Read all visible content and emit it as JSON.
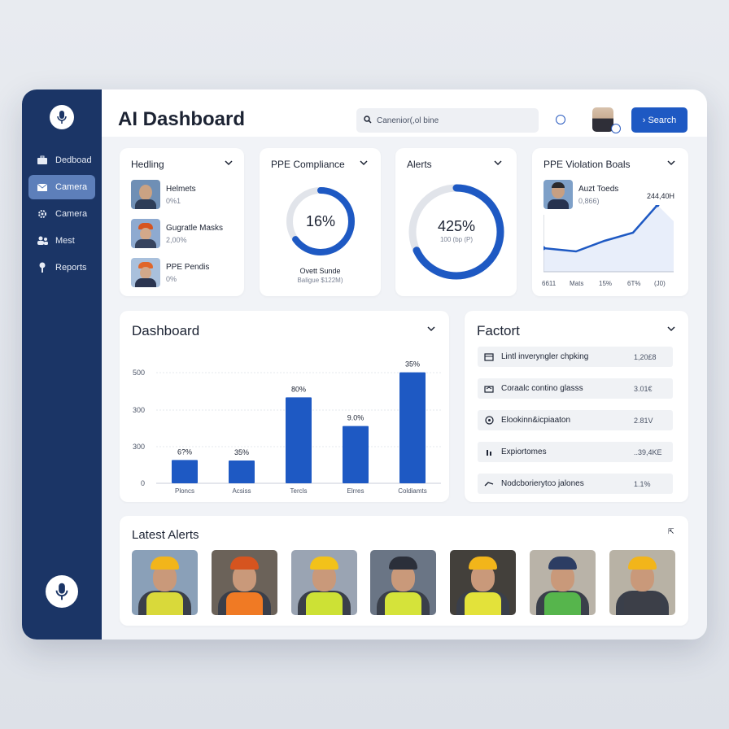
{
  "app": {
    "title": "AI Dashboard"
  },
  "search": {
    "placeholder": "Canenior(,ol bine",
    "button_label": "Search"
  },
  "sidebar": {
    "items": [
      {
        "label": "Dedboad",
        "icon": "briefcase-icon",
        "active": false
      },
      {
        "label": "Camera",
        "icon": "mail-icon",
        "active": true
      },
      {
        "label": "Camera",
        "icon": "gear-icon",
        "active": false
      },
      {
        "label": "Mest",
        "icon": "people-icon",
        "active": false
      },
      {
        "label": "Reports",
        "icon": "pin-icon",
        "active": false
      }
    ]
  },
  "cards": {
    "hedling": {
      "title": "Hedling",
      "rows": [
        {
          "name": "Helmets",
          "value": "0%1"
        },
        {
          "name": "Gugratle Masks",
          "value": "2,00%"
        },
        {
          "name": "PPE Pendis",
          "value": "0%"
        }
      ]
    },
    "compliance": {
      "title": "PPE Compliance",
      "value": "16%",
      "sub1": "Ovett Sunde",
      "sub2": "Baligue $122M)",
      "percent": 65
    },
    "alerts": {
      "title": "Alerts",
      "value": "425%",
      "sub": "100 (bp (P)",
      "percent": 68
    },
    "violation": {
      "title": "PPE Violation Boals",
      "name": "Auzt Toeds",
      "sub": "0,866)",
      "peak_label": "244,40H",
      "xlabels": [
        "6611",
        "Mats",
        "15%",
        "6T%",
        "(J0)"
      ]
    }
  },
  "dashboard": {
    "title": "Dashboard",
    "chart_data": {
      "type": "bar",
      "categories": [
        "Ploncs",
        "Acsiss",
        "Tercls",
        "Elrres",
        "Coldiamts"
      ],
      "values": [
        130,
        127,
        480,
        320,
        620
      ],
      "data_labels": [
        "6?%",
        "35%",
        "80%",
        "9.0%",
        "35%"
      ],
      "yticks": [
        "500",
        "300",
        "300",
        "0"
      ],
      "ylim": [
        0,
        700
      ]
    }
  },
  "factort": {
    "title": "Factort",
    "rows": [
      {
        "label": "Lintl inveryngler chpking",
        "value": "1,20£8",
        "icon": "box-icon"
      },
      {
        "label": "Coraalc contino glasss",
        "value": "3.01€",
        "icon": "glasses-icon"
      },
      {
        "label": "Elookinn&icpiaaton",
        "value": "2.81V",
        "icon": "face-icon"
      },
      {
        "label": "Expiortomes",
        "value": "..39,4KE",
        "icon": "people-small-icon"
      },
      {
        "label": "Nodcborierytoɔ jalones",
        "value": "1.1%",
        "icon": "arrow-icon"
      }
    ]
  },
  "latest_alerts": {
    "title": "Latest Alerts",
    "photos": [
      {
        "name": "worker-1",
        "helmet": "#f2b51a",
        "vest": "#d9d93a",
        "bg": "#8aa0b8"
      },
      {
        "name": "worker-2",
        "helmet": "#d6541f",
        "vest": "#f07a24",
        "bg": "#6b6259"
      },
      {
        "name": "worker-3",
        "helmet": "#f2c21a",
        "vest": "#cde135",
        "bg": "#9aa4b3"
      },
      {
        "name": "worker-4",
        "helmet": "#2b2f3a",
        "vest": "#d5e33a",
        "bg": "#6a7585"
      },
      {
        "name": "worker-5",
        "helmet": "#f2b51a",
        "vest": "#e3e23a",
        "bg": "#43403b"
      },
      {
        "name": "worker-6",
        "helmet": "#2c3d63",
        "vest": "#56b54c",
        "bg": "#b9b3a8"
      },
      {
        "name": "worker-7",
        "helmet": "#f2b51a",
        "vest": "#3c3f48",
        "bg": "#b8b2a5"
      }
    ]
  },
  "colors": {
    "sidebar": "#1b3566",
    "accent": "#1e59c3",
    "active_nav": "#5d7fba"
  }
}
